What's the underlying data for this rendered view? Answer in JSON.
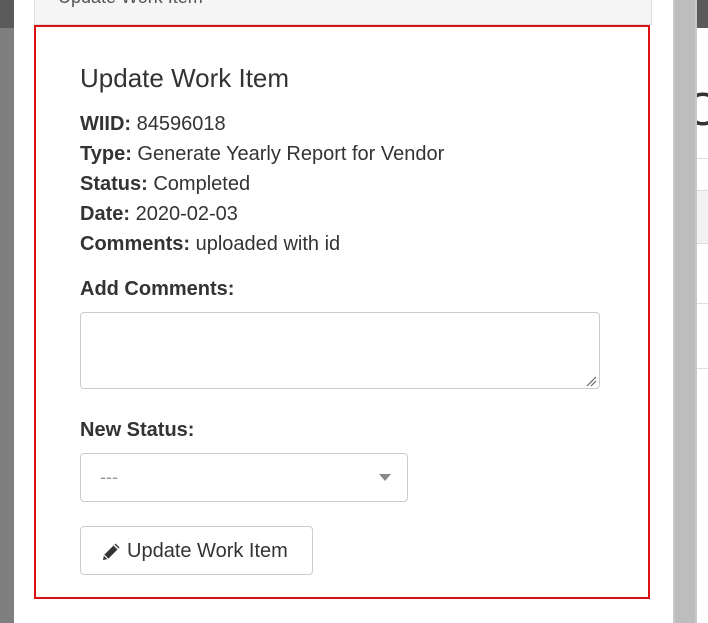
{
  "modal": {
    "header_title": "Update Work Item",
    "title": "Update Work Item",
    "details": [
      {
        "label": "WIID:",
        "value": "84596018"
      },
      {
        "label": "Type:",
        "value": "Generate Yearly Report for Vendor"
      },
      {
        "label": "Status:",
        "value": "Completed"
      },
      {
        "label": "Date:",
        "value": "2020-02-03"
      },
      {
        "label": "Comments:",
        "value": "uploaded with id"
      }
    ],
    "add_comments_label": "Add Comments:",
    "comments_value": "",
    "new_status_label": "New Status:",
    "new_status_selected": "---",
    "submit_button_label": "Update Work Item",
    "submit_button_icon": "pencil-icon"
  },
  "background": {
    "partial_glyph": "O"
  },
  "colors": {
    "highlight_border": "#dd1111",
    "backdrop": "#5a5a5a"
  }
}
